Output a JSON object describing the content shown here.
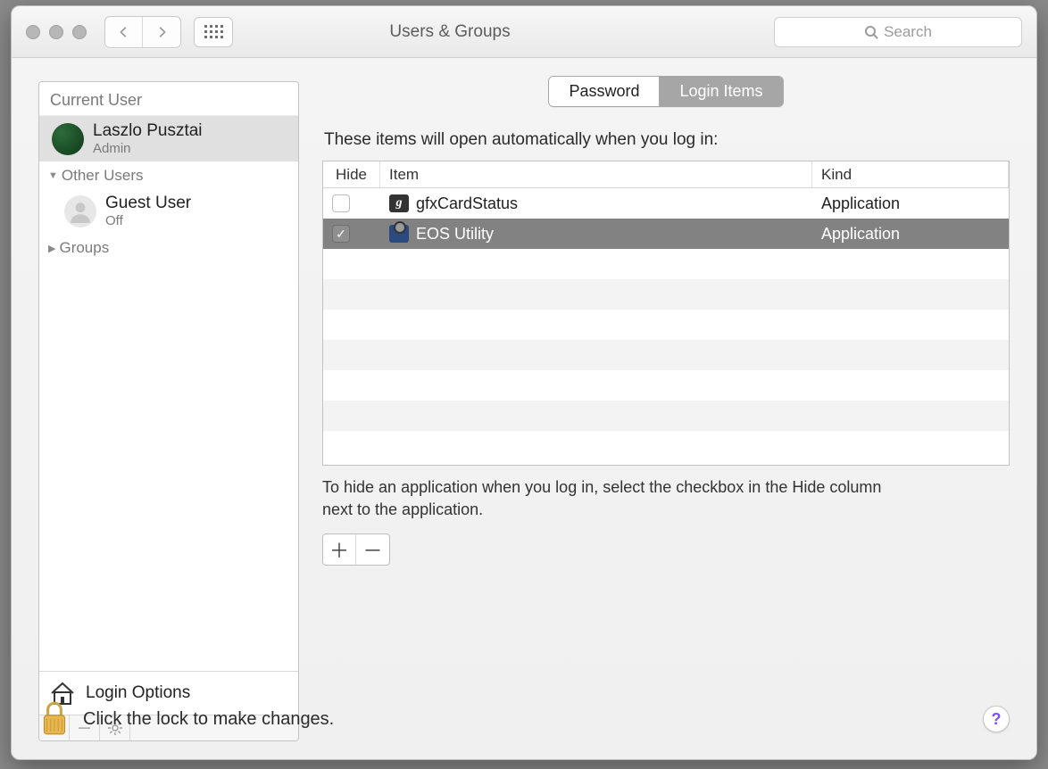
{
  "window_title": "Users & Groups",
  "search": {
    "placeholder": "Search"
  },
  "sidebar": {
    "current_user_header": "Current User",
    "current_user": {
      "name": "Laszlo Pusztai",
      "role": "Admin"
    },
    "other_users_header": "Other Users",
    "guest": {
      "name": "Guest User",
      "status": "Off"
    },
    "groups_header": "Groups",
    "login_options_label": "Login Options"
  },
  "tabs": {
    "password": "Password",
    "login_items": "Login Items"
  },
  "intro_text": "These items will open automatically when you log in:",
  "columns": {
    "hide": "Hide",
    "item": "Item",
    "kind": "Kind"
  },
  "items": [
    {
      "hide": false,
      "name": "gfxCardStatus",
      "kind": "Application",
      "selected": false,
      "icon": "g"
    },
    {
      "hide": true,
      "name": "EOS Utility",
      "kind": "Application",
      "selected": true,
      "icon": "cam"
    }
  ],
  "hint_text": "To hide an application when you log in, select the checkbox in the Hide column next to the application.",
  "lock_text": "Click the lock to make changes.",
  "help_label": "?"
}
